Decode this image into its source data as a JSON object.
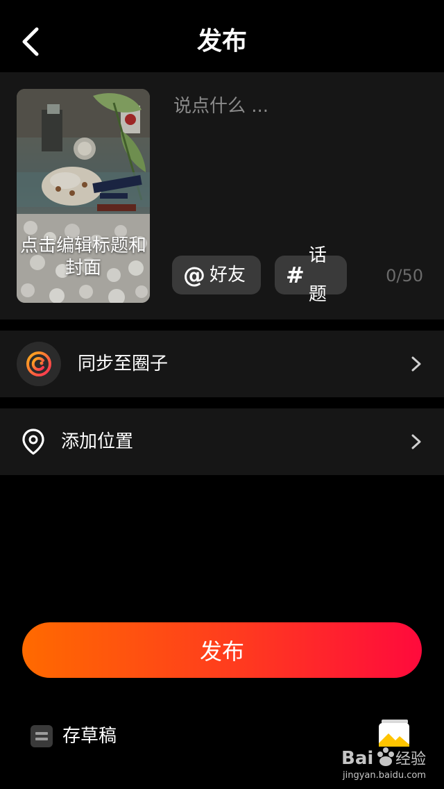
{
  "header": {
    "title": "发布"
  },
  "compose": {
    "cover_label": "点击编辑标题和封面",
    "text_placeholder": "说点什么 ...",
    "friends_chip": {
      "symbol": "@",
      "label": "好友"
    },
    "topic_chip": {
      "symbol": "#",
      "label": "话题"
    },
    "char_counter": "0/50"
  },
  "rows": {
    "sync_label": "同步至圈子",
    "location_label": "添加位置"
  },
  "actions": {
    "publish_label": "发布",
    "draft_label": "存草稿"
  },
  "colors": {
    "accent_start": "#ff6a00",
    "accent_end": "#ff0a3c"
  },
  "icons": [
    "back-icon",
    "circle-sync-icon",
    "location-pin-icon",
    "chevron-right-icon",
    "draft-icon",
    "gallery-icon"
  ]
}
